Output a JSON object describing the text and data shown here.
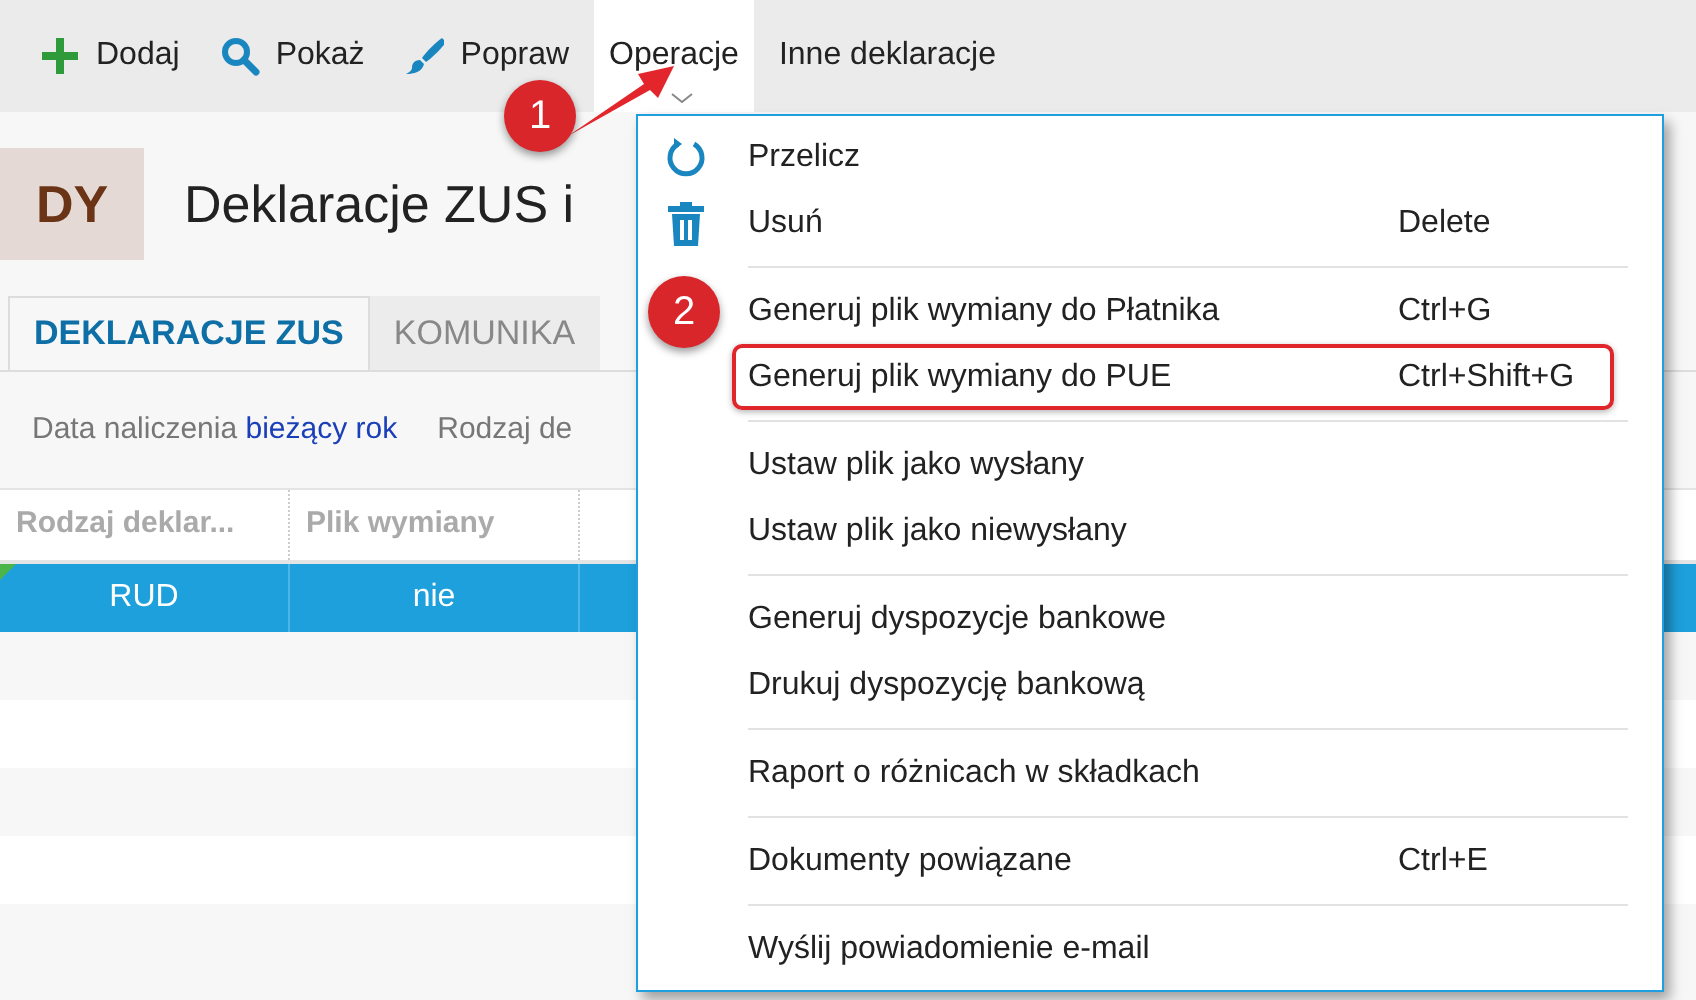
{
  "toolbar": [
    {
      "label": "Dodaj",
      "kind": "add",
      "selected": false
    },
    {
      "label": "Pokaż",
      "kind": "search",
      "selected": false
    },
    {
      "label": "Popraw",
      "kind": "edit",
      "selected": false
    },
    {
      "label": "Operacje",
      "kind": "menu",
      "selected": true
    },
    {
      "label": "Inne deklaracje",
      "kind": "plain",
      "selected": false
    }
  ],
  "header": {
    "badge": "DY",
    "title": "Deklaracje ZUS i"
  },
  "tabs": [
    {
      "label": "DEKLARACJE ZUS",
      "selected": true
    },
    {
      "label": "KOMUNIKA",
      "selected": false
    }
  ],
  "filters": [
    {
      "label": "Data naliczenia",
      "value": "bieżący rok"
    },
    {
      "label": "Rodzaj de"
    }
  ],
  "table": {
    "columns": [
      "Rodzaj deklar...",
      "Plik wymiany"
    ],
    "rows": [
      {
        "cells": [
          "RUD",
          "nie"
        ],
        "selected": true
      }
    ]
  },
  "menu": {
    "groups": [
      [
        {
          "label": "Przelicz",
          "kind": "refresh",
          "outlined": false
        },
        {
          "label": "Usuń",
          "shortcut": "Delete",
          "kind": "trash",
          "outlined": false
        }
      ],
      [
        {
          "label": "Generuj plik wymiany do Płatnika",
          "shortcut": "Ctrl+G",
          "kind": "plain",
          "outlined": false
        },
        {
          "label": "Generuj plik wymiany do PUE",
          "shortcut": "Ctrl+Shift+G",
          "kind": "plain",
          "outlined": true
        }
      ],
      [
        {
          "label": "Ustaw plik jako wysłany",
          "kind": "plain",
          "outlined": false
        },
        {
          "label": "Ustaw plik jako niewysłany",
          "kind": "plain",
          "outlined": false
        }
      ],
      [
        {
          "label": "Generuj dyspozycje bankowe",
          "kind": "plain",
          "outlined": false
        },
        {
          "label": "Drukuj dyspozycję bankową",
          "kind": "plain",
          "outlined": false
        }
      ],
      [
        {
          "label": "Raport o różnicach w składkach",
          "kind": "plain",
          "outlined": false
        }
      ],
      [
        {
          "label": "Dokumenty powiązane",
          "shortcut": "Ctrl+E",
          "kind": "plain",
          "outlined": false
        }
      ],
      [
        {
          "label": "Wyślij powiadomienie e-mail",
          "kind": "plain",
          "outlined": false
        }
      ]
    ]
  },
  "callouts": [
    {
      "label": "1"
    },
    {
      "label": "2"
    }
  ]
}
